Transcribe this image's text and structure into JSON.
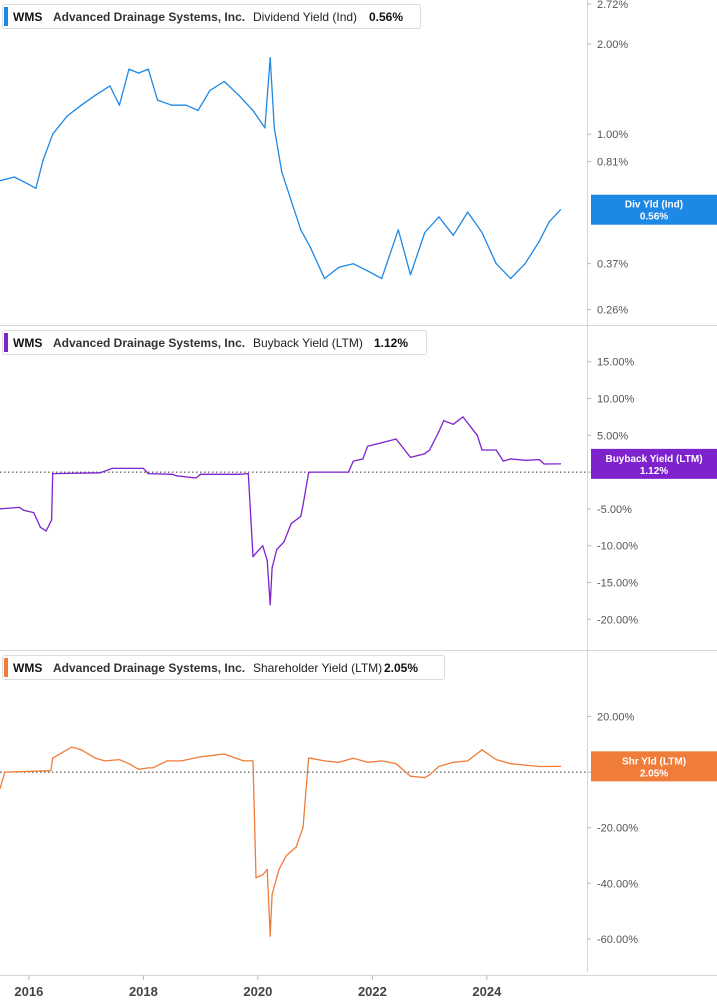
{
  "chart_data": [
    {
      "type": "line",
      "ticker": "WMS",
      "company": "Advanced Drainage Systems, Inc.",
      "metric": "Dividend Yield (Ind)",
      "current_value": "0.56%",
      "badge_label": "Div Yld (Ind)",
      "badge_value": "0.56%",
      "color": "#1e88e5",
      "y_scale": "log",
      "ylim": [
        0.24,
        2.72
      ],
      "y_ticks": [
        {
          "value": 2.72,
          "label": "2.72%"
        },
        {
          "value": 2.0,
          "label": "2.00%"
        },
        {
          "value": 1.0,
          "label": "1.00%"
        },
        {
          "value": 0.81,
          "label": "0.81%"
        },
        {
          "value": 0.37,
          "label": "0.37%"
        },
        {
          "value": 0.26,
          "label": "0.26%"
        }
      ],
      "series": [
        {
          "x": [
            "2015-07-01",
            "2015-10-01",
            "2016-01-01",
            "2016-02-15",
            "2016-04-01",
            "2016-06-01",
            "2016-09-01",
            "2016-12-01",
            "2017-03-01",
            "2017-06-01",
            "2017-08-01",
            "2017-10-01",
            "2017-12-01",
            "2018-02-01",
            "2018-04-01",
            "2018-07-01",
            "2018-10-01",
            "2018-12-15",
            "2019-03-01",
            "2019-06-01",
            "2019-09-01",
            "2019-12-01",
            "2020-02-15",
            "2020-03-20",
            "2020-04-15",
            "2020-06-01",
            "2020-08-01",
            "2020-10-01",
            "2020-12-01",
            "2021-03-01",
            "2021-06-01",
            "2021-09-01",
            "2021-12-01",
            "2022-03-01",
            "2022-06-15",
            "2022-09-01",
            "2022-12-01",
            "2023-03-01",
            "2023-06-01",
            "2023-09-01",
            "2023-12-01",
            "2024-03-01",
            "2024-06-01",
            "2024-09-01",
            "2024-12-01",
            "2025-02-01",
            "2025-04-15"
          ],
          "y": [
            0.7,
            0.72,
            0.68,
            0.66,
            0.82,
            1.0,
            1.15,
            1.25,
            1.35,
            1.45,
            1.25,
            1.65,
            1.6,
            1.65,
            1.3,
            1.25,
            1.25,
            1.2,
            1.4,
            1.5,
            1.35,
            1.2,
            1.05,
            1.8,
            1.05,
            0.75,
            0.6,
            0.48,
            0.42,
            0.33,
            0.36,
            0.37,
            0.35,
            0.33,
            0.48,
            0.34,
            0.47,
            0.53,
            0.46,
            0.55,
            0.47,
            0.37,
            0.33,
            0.37,
            0.44,
            0.51,
            0.56
          ]
        }
      ]
    },
    {
      "type": "line",
      "ticker": "WMS",
      "company": "Advanced Drainage Systems, Inc.",
      "metric": "Buyback Yield (LTM)",
      "current_value": "1.12%",
      "badge_label": "Buyback Yield (LTM)",
      "badge_value": "1.12%",
      "color": "#7e22ce",
      "ylim": [
        -22,
        17
      ],
      "y_ticks": [
        {
          "value": 15,
          "label": "15.00%"
        },
        {
          "value": 10,
          "label": "10.00%"
        },
        {
          "value": 5,
          "label": "5.00%"
        },
        {
          "value": 0,
          "label": "0.00%"
        },
        {
          "value": -5,
          "label": "-5.00%"
        },
        {
          "value": -10,
          "label": "-10.00%"
        },
        {
          "value": -15,
          "label": "-15.00%"
        },
        {
          "value": -20,
          "label": "-20.00%"
        }
      ],
      "series": [
        {
          "x": [
            "2015-07-01",
            "2015-11-01",
            "2015-12-01",
            "2016-02-01",
            "2016-03-15",
            "2016-04-20",
            "2016-05-25",
            "2016-06-01",
            "2017-04-01",
            "2017-06-15",
            "2017-08-01",
            "2018-01-01",
            "2018-02-01",
            "2018-07-01",
            "2018-08-01",
            "2018-12-01",
            "2019-01-01",
            "2019-08-01",
            "2019-09-01",
            "2019-11-01",
            "2019-12-01",
            "2019-12-20",
            "2020-02-01",
            "2020-03-01",
            "2020-03-20",
            "2020-04-01",
            "2020-05-01",
            "2020-06-15",
            "2020-08-01",
            "2020-10-01",
            "2020-10-15",
            "2020-11-20",
            "2020-12-01",
            "2021-08-01",
            "2021-09-01",
            "2021-11-01",
            "2021-12-01",
            "2022-03-01",
            "2022-06-01",
            "2022-09-01",
            "2022-12-01",
            "2023-01-01",
            "2023-03-01",
            "2023-04-01",
            "2023-06-01",
            "2023-08-01",
            "2023-11-01",
            "2023-12-01",
            "2024-03-01",
            "2024-04-15",
            "2024-06-01",
            "2024-09-01",
            "2024-12-01",
            "2025-01-01",
            "2025-04-15"
          ],
          "y": [
            -5.0,
            -4.8,
            -5.2,
            -5.5,
            -7.5,
            -8.0,
            -6.5,
            -0.2,
            -0.1,
            0.5,
            0.5,
            0.5,
            -0.2,
            -0.3,
            -0.5,
            -0.8,
            -0.3,
            -0.3,
            -0.3,
            -0.2,
            -11.5,
            -11.0,
            -10.0,
            -12.0,
            -18.0,
            -13.0,
            -10.5,
            -9.5,
            -7.0,
            -6.0,
            -4.5,
            -0.1,
            0.0,
            0.0,
            1.5,
            1.8,
            3.5,
            4.0,
            4.5,
            2.0,
            2.5,
            3.0,
            5.5,
            7.0,
            6.5,
            7.5,
            5.0,
            3.0,
            3.0,
            1.5,
            1.8,
            1.6,
            1.7,
            1.1,
            1.12
          ]
        }
      ]
    },
    {
      "type": "line",
      "ticker": "WMS",
      "company": "Advanced Drainage Systems, Inc.",
      "metric": "Shareholder Yield (LTM)",
      "current_value": "2.05%",
      "badge_label": "Shr Yld (LTM)",
      "badge_value": "2.05%",
      "color": "#f07c3a",
      "ylim": [
        -64,
        27
      ],
      "y_ticks": [
        {
          "value": 20,
          "label": "20.00%"
        },
        {
          "value": 0,
          "label": "0.00%"
        },
        {
          "value": -20,
          "label": "-20.00%"
        },
        {
          "value": -40,
          "label": "-40.00%"
        },
        {
          "value": -60,
          "label": "-60.00%"
        }
      ],
      "series": [
        {
          "x": [
            "2015-07-01",
            "2015-08-01",
            "2016-05-20",
            "2016-06-01",
            "2016-08-01",
            "2016-10-01",
            "2016-12-01",
            "2017-03-01",
            "2017-05-01",
            "2017-08-01",
            "2017-10-01",
            "2017-12-01",
            "2018-02-01",
            "2018-03-01",
            "2018-06-01",
            "2018-09-01",
            "2019-01-01",
            "2019-06-01",
            "2019-10-01",
            "2019-12-01",
            "2019-12-20",
            "2020-02-01",
            "2020-03-01",
            "2020-03-20",
            "2020-04-01",
            "2020-05-15",
            "2020-07-01",
            "2020-09-01",
            "2020-10-15",
            "2020-11-20",
            "2020-12-01",
            "2021-03-01",
            "2021-06-01",
            "2021-09-01",
            "2021-12-01",
            "2022-03-01",
            "2022-06-01",
            "2022-09-01",
            "2022-12-01",
            "2023-01-01",
            "2023-03-01",
            "2023-06-01",
            "2023-09-01",
            "2023-12-01",
            "2024-03-01",
            "2024-06-01",
            "2024-09-01",
            "2024-12-01",
            "2025-04-15"
          ],
          "y": [
            -6.0,
            0.0,
            0.5,
            5.0,
            7.0,
            9.0,
            8.0,
            5.0,
            4.0,
            4.5,
            3.0,
            1.0,
            1.5,
            1.5,
            4.0,
            4.0,
            5.5,
            6.5,
            4.0,
            4.0,
            -38.0,
            -37.0,
            -35.0,
            -59.0,
            -44.0,
            -35.0,
            -30.0,
            -27.0,
            -20.0,
            5.0,
            5.0,
            4.0,
            3.5,
            5.0,
            3.5,
            4.0,
            3.0,
            -1.5,
            -2.0,
            -1.0,
            2.0,
            3.5,
            4.0,
            8.0,
            4.5,
            3.0,
            2.5,
            2.0,
            2.05
          ]
        }
      ]
    }
  ],
  "x_axis": {
    "ticks": [
      {
        "value": "2016-01-01",
        "label": "2016"
      },
      {
        "value": "2018-01-01",
        "label": "2018"
      },
      {
        "value": "2020-01-01",
        "label": "2020"
      },
      {
        "value": "2022-01-01",
        "label": "2022"
      },
      {
        "value": "2024-01-01",
        "label": "2024"
      }
    ],
    "range": [
      "2015-07-01",
      "2025-10-01"
    ]
  }
}
